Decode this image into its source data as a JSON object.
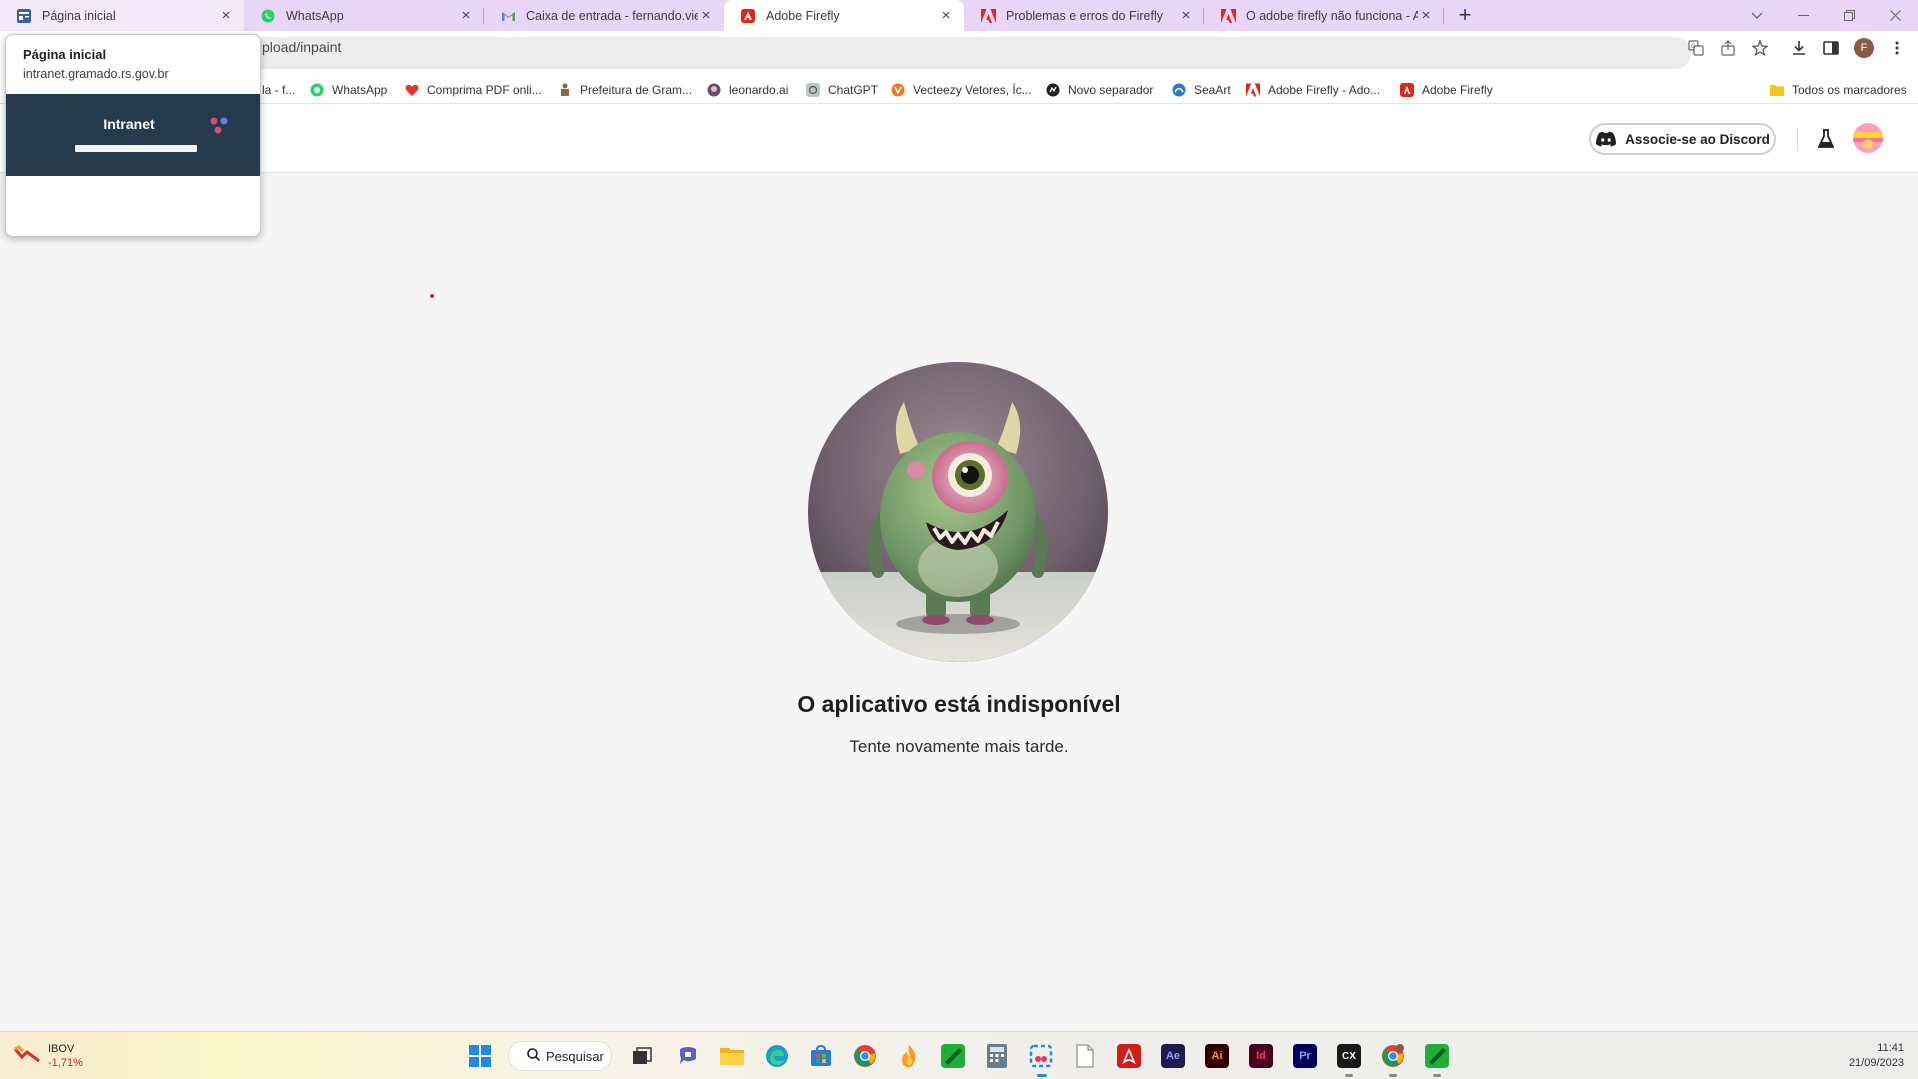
{
  "tabs": [
    {
      "title": "Página inicial",
      "icon": "intranet-icon",
      "state": "hover"
    },
    {
      "title": "WhatsApp",
      "icon": "whatsapp-icon",
      "state": "normal"
    },
    {
      "title": "Caixa de entrada - fernando.vieg",
      "icon": "gmail-icon",
      "state": "normal"
    },
    {
      "title": "Adobe Firefly",
      "icon": "adobe-icon",
      "state": "active"
    },
    {
      "title": "Problemas e erros do Firefly",
      "icon": "adobe-icon",
      "state": "normal"
    },
    {
      "title": "O adobe firefly não funciona - Ac",
      "icon": "adobe-icon",
      "state": "normal"
    }
  ],
  "toolbar": {
    "url_visible": "pload/inpaint",
    "profile_initial": "F"
  },
  "bookmarks": [
    {
      "label": "la - f...",
      "icon": "bookmark-icon"
    },
    {
      "label": "WhatsApp",
      "icon": "whatsapp-icon"
    },
    {
      "label": "Comprima PDF onli...",
      "icon": "heart-icon"
    },
    {
      "label": "Prefeitura de Gram...",
      "icon": "prefeitura-icon"
    },
    {
      "label": "leonardo.ai",
      "icon": "leonardo-icon"
    },
    {
      "label": "ChatGPT",
      "icon": "chatgpt-icon"
    },
    {
      "label": "Vecteezy Vetores, Íc...",
      "icon": "vecteezy-icon"
    },
    {
      "label": "Novo separador",
      "icon": "globe-icon"
    },
    {
      "label": "SeaArt",
      "icon": "seaart-icon"
    },
    {
      "label": "Adobe Firefly - Ado...",
      "icon": "adobe-icon"
    },
    {
      "label": "Adobe Firefly",
      "icon": "adobe-icon"
    }
  ],
  "all_bookmarks": "Todos os marcadores",
  "app": {
    "discord_label": "Associe-se ao Discord"
  },
  "message": {
    "title": "O aplicativo está indisponível",
    "subtitle": "Tente novamente mais tarde."
  },
  "hovercard": {
    "title": "Página inicial",
    "url": "intranet.gramado.rs.gov.br",
    "thumbnail_title": "Intranet"
  },
  "taskbar": {
    "ticker_name": "IBOV",
    "ticker_value": "-1,71%",
    "search_label": "Pesquisar",
    "apps": [
      "windows-start-icon",
      "task-view-icon",
      "teams-icon",
      "file-explorer-icon",
      "edge-icon",
      "store-icon",
      "chrome-icon",
      "fire-icon",
      "app-green-icon",
      "calculator-icon",
      "snipping-tool-icon",
      "notepad-icon",
      "acrobat-icon",
      "after-effects-icon",
      "illustrator-icon",
      "indesign-icon",
      "premiere-icon",
      "capcut-icon",
      "chrome-profile-icon",
      "app-green-2-icon"
    ],
    "app_labels": {
      "after_effects": "Ae",
      "illustrator": "Ai",
      "indesign": "Id",
      "premiere": "Pr",
      "capcut": "CX"
    },
    "time": "11:41",
    "date": "21/09/2023"
  },
  "colors": {
    "tabstrip_bg": "#e9d5f7",
    "adobe_red": "#e1251b",
    "discord_blurple": "#5865f2"
  }
}
